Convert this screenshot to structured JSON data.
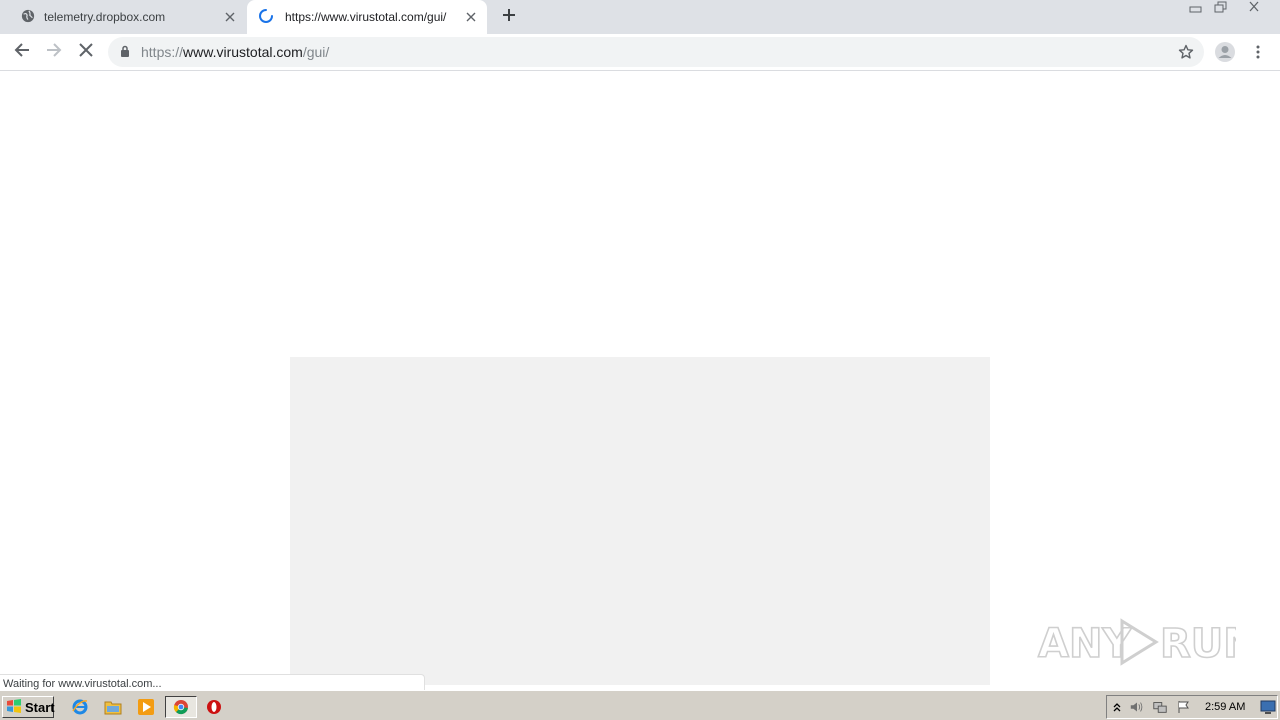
{
  "browser": {
    "tabs": [
      {
        "title": "telemetry.dropbox.com",
        "active": false
      },
      {
        "title": "https://www.virustotal.com/gui/",
        "active": true
      }
    ],
    "address_bar": {
      "scheme": "https://",
      "host": "www.virustotal.com",
      "path": "/gui/"
    },
    "status_text": "Waiting for www.virustotal.com..."
  },
  "watermark": {
    "text": "ANY RUN"
  },
  "taskbar": {
    "start_label": "Start",
    "pinned": [
      "ie-icon",
      "explorer-icon",
      "media-player-icon",
      "chrome-icon",
      "opera-icon"
    ],
    "clock": "2:59 AM"
  },
  "colors": {
    "tabstrip_bg": "#dee1e6",
    "omnibox_bg": "#f1f3f4",
    "placeholder_bg": "#f1f1f1",
    "taskbar_bg": "#d4d0c8",
    "spinner": "#1a73e8"
  }
}
